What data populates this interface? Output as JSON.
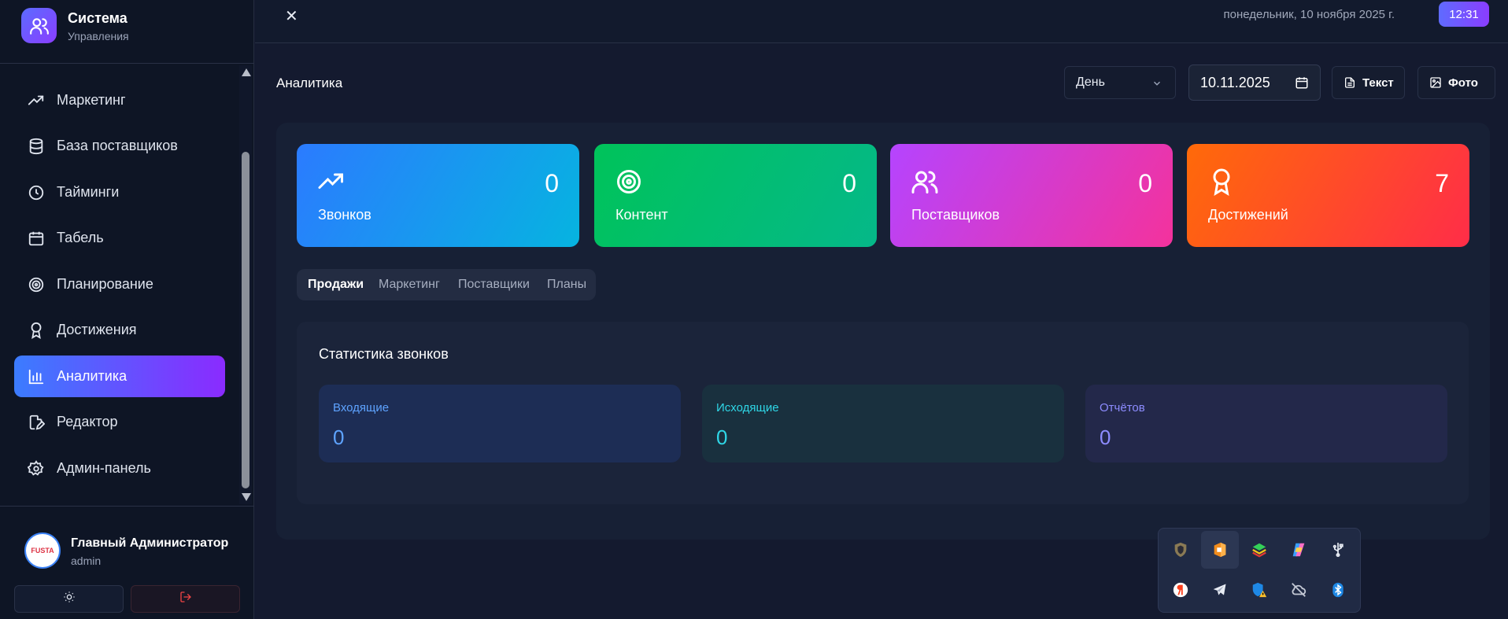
{
  "brand": {
    "title": "Система",
    "subtitle": "Управления"
  },
  "sidebar": {
    "items": [
      {
        "label": "Маркетинг",
        "icon": "trending-up-icon"
      },
      {
        "label": "База поставщиков",
        "icon": "database-icon"
      },
      {
        "label": "Тайминги",
        "icon": "clock-icon"
      },
      {
        "label": "Табель",
        "icon": "calendar-icon"
      },
      {
        "label": "Планирование",
        "icon": "target-icon"
      },
      {
        "label": "Достижения",
        "icon": "award-icon"
      },
      {
        "label": "Аналитика",
        "icon": "bar-chart-icon",
        "active": true
      },
      {
        "label": "Редактор",
        "icon": "file-edit-icon"
      },
      {
        "label": "Админ-панель",
        "icon": "gear-icon"
      }
    ]
  },
  "user": {
    "name": "Главный Администратор",
    "role": "admin",
    "avatar_text": "FUSTA"
  },
  "topbar": {
    "date": "понедельник, 10 ноября 2025 г.",
    "time": "12:31"
  },
  "page": {
    "title": "Аналитика",
    "period": "День",
    "date_value": "10.11.2025",
    "text_button": "Текст",
    "photo_button": "Фото"
  },
  "stats": [
    {
      "label": "Звонков",
      "value": "0",
      "icon": "trending-up-icon"
    },
    {
      "label": "Контент",
      "value": "0",
      "icon": "target-icon"
    },
    {
      "label": "Поставщиков",
      "value": "0",
      "icon": "users-icon"
    },
    {
      "label": "Достижений",
      "value": "7",
      "icon": "award-icon"
    }
  ],
  "tabs": [
    {
      "label": "Продажи",
      "active": true
    },
    {
      "label": "Маркетинг"
    },
    {
      "label": "Поставщики"
    },
    {
      "label": "Планы"
    }
  ],
  "calls_panel": {
    "title": "Статистика звонков",
    "cards": [
      {
        "label": "Входящие",
        "value": "0"
      },
      {
        "label": "Исходящие",
        "value": "0"
      },
      {
        "label": "Отчётов",
        "value": "0"
      }
    ]
  },
  "tray": {
    "icons": [
      "shield-app-icon",
      "office-app-icon",
      "bluestacks-icon",
      "copilot-icon",
      "usb-icon",
      "yandex-icon",
      "telegram-icon",
      "defender-warning-icon",
      "cloud-off-icon",
      "bluetooth-icon"
    ]
  },
  "colors": {
    "accent_start": "#3b7cff",
    "accent_end": "#8a2bff",
    "incoming": "#5ea3ff",
    "outgoing": "#2fd6e6",
    "reports": "#8d8cff"
  }
}
